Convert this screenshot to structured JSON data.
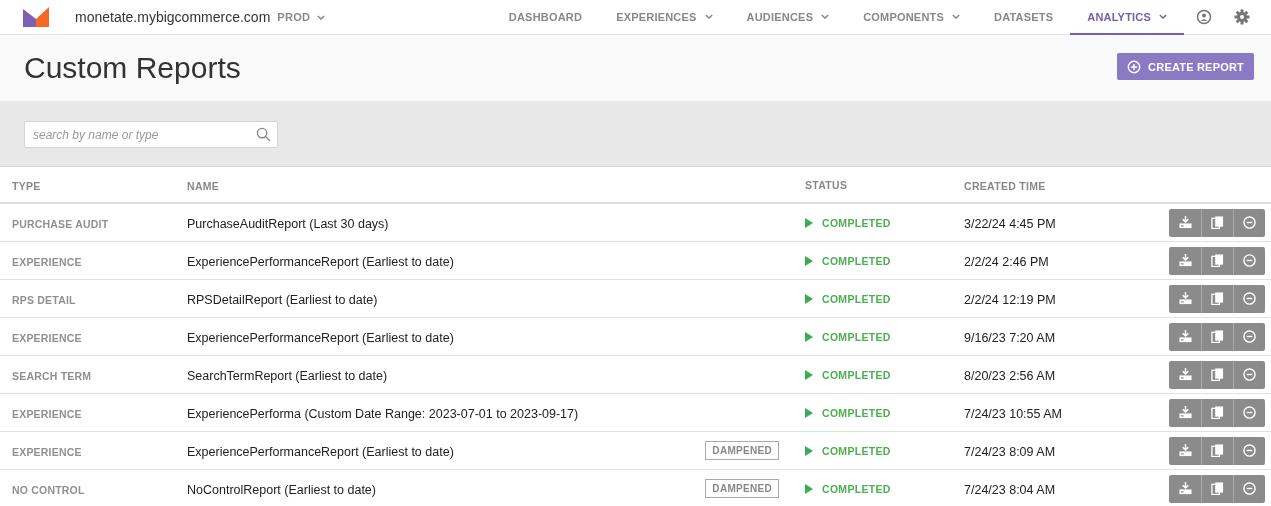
{
  "topbar": {
    "site": "monetate.mybigcommerce.com",
    "environment": "PROD",
    "nav": [
      {
        "label": "DASHBOARD",
        "dropdown": false,
        "selected": false
      },
      {
        "label": "EXPERIENCES",
        "dropdown": true,
        "selected": false
      },
      {
        "label": "AUDIENCES",
        "dropdown": true,
        "selected": false
      },
      {
        "label": "COMPONENTS",
        "dropdown": true,
        "selected": false
      },
      {
        "label": "DATASETS",
        "dropdown": false,
        "selected": false
      },
      {
        "label": "ANALYTICS",
        "dropdown": true,
        "selected": true
      }
    ]
  },
  "page": {
    "title": "Custom Reports",
    "create_button": "CREATE REPORT"
  },
  "search": {
    "placeholder": "search by name or type"
  },
  "table": {
    "columns": [
      "TYPE",
      "NAME",
      "STATUS",
      "CREATED TIME"
    ],
    "rows": [
      {
        "type": "PURCHASE AUDIT",
        "name": "PurchaseAuditReport (Last 30 days)",
        "tag": null,
        "status": "COMPLETED",
        "created": "3/22/24 4:45 PM"
      },
      {
        "type": "EXPERIENCE",
        "name": "ExperiencePerformanceReport (Earliest to date)",
        "tag": null,
        "status": "COMPLETED",
        "created": "2/2/24 2:46 PM"
      },
      {
        "type": "RPS DETAIL",
        "name": "RPSDetailReport (Earliest to date)",
        "tag": null,
        "status": "COMPLETED",
        "created": "2/2/24 12:19 PM"
      },
      {
        "type": "EXPERIENCE",
        "name": "ExperiencePerformanceReport (Earliest to date)",
        "tag": null,
        "status": "COMPLETED",
        "created": "9/16/23 7:20 AM"
      },
      {
        "type": "SEARCH TERM",
        "name": "SearchTermReport (Earliest to date)",
        "tag": null,
        "status": "COMPLETED",
        "created": "8/20/23 2:56 AM"
      },
      {
        "type": "EXPERIENCE",
        "name": "ExperiencePerforma (Custom Date Range: 2023-07-01 to 2023-09-17)",
        "tag": null,
        "status": "COMPLETED",
        "created": "7/24/23 10:55 AM"
      },
      {
        "type": "EXPERIENCE",
        "name": "ExperiencePerformanceReport (Earliest to date)",
        "tag": "DAMPENED",
        "status": "COMPLETED",
        "created": "7/24/23 8:09 AM"
      },
      {
        "type": "NO CONTROL",
        "name": "NoControlReport (Earliest to date)",
        "tag": "DAMPENED",
        "status": "COMPLETED",
        "created": "7/24/23 8:04 AM"
      }
    ]
  }
}
